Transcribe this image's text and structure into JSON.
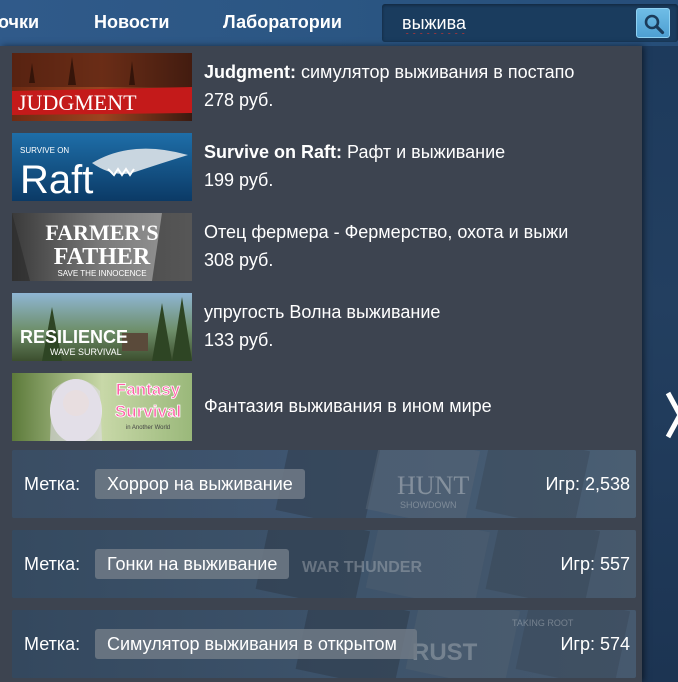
{
  "nav": {
    "items": [
      "очки",
      "Новости",
      "Лаборатории"
    ]
  },
  "search": {
    "value": "выжива",
    "icon": "search-icon"
  },
  "results": [
    {
      "name_bold": "Judgment:",
      "name_rest": " симулятор выживания в постапо",
      "price": "278 руб.",
      "thumb_text": "JUDGMENT"
    },
    {
      "name_bold": "Survive on Raft:",
      "name_rest": " Рафт и выживание",
      "price": "199 руб.",
      "thumb_small": "SURVIVE ON",
      "thumb_text": "Raft"
    },
    {
      "name_bold": "",
      "name_rest": "Отец фермера - Фермерство, охота и выжи",
      "price": "308 руб.",
      "thumb_line1": "FARMER'S",
      "thumb_line2": "FATHER",
      "thumb_small": "SAVE THE INNOCENCE"
    },
    {
      "name_bold": "",
      "name_rest": "упругость Волна выживание",
      "price": "133 руб.",
      "thumb_text": "RESILIENCE",
      "thumb_small": "WAVE SURVIVAL"
    },
    {
      "name_bold": "",
      "name_rest": "Фантазия выживания в ином мире",
      "price": "",
      "thumb_line1": "Fantasy",
      "thumb_line2": "Survival",
      "thumb_small": "in Another World"
    }
  ],
  "tags": [
    {
      "label": "Метка:",
      "name": "Хоррор на выживание",
      "count": "Игр: 2,538",
      "bg_word": "HUNT",
      "bg_small": "SHOWDOWN"
    },
    {
      "label": "Метка:",
      "name": "Гонки на выживание",
      "count": "Игр: 557",
      "bg_word": "WAR THUNDER",
      "bg_small": ""
    },
    {
      "label": "Метка:",
      "name": "Симулятор выживания в открытом",
      "count": "Игр: 574",
      "bg_word": "RUST",
      "bg_small": "TAKING ROOT"
    }
  ],
  "colors": {
    "nav_bg": "#2b5683",
    "dropdown_bg": "#3d4450",
    "search_button": "#5aaedd",
    "spellcheck_underline": "#d0322e"
  }
}
